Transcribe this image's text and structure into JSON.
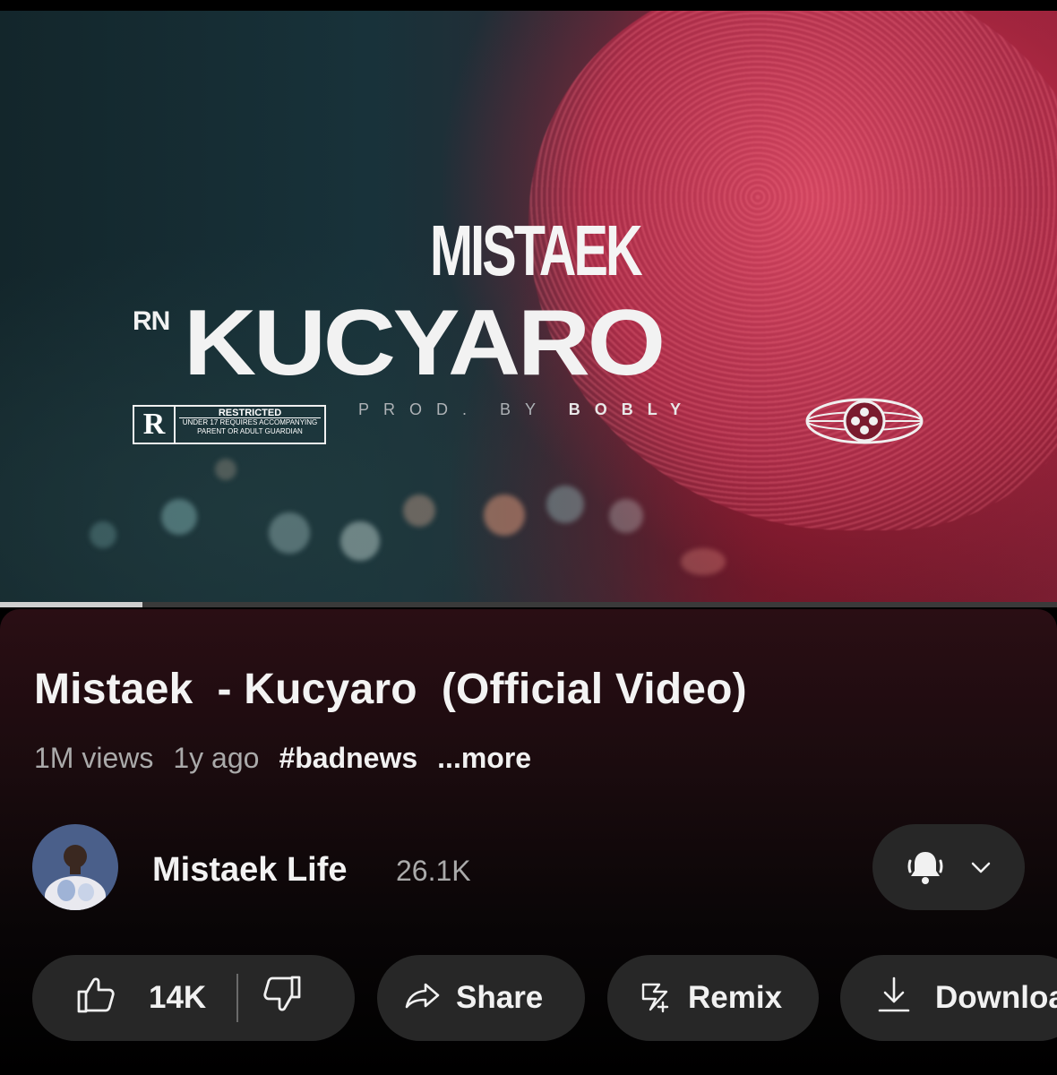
{
  "video": {
    "artist_logo": "MISTAEK",
    "feature_logo": "RN",
    "song_logo": "KUCYARO",
    "prod_label": "PROD. BY",
    "producer": "BOBLY",
    "rating": {
      "letter": "R",
      "heading": "RESTRICTED",
      "line1": "UNDER 17 REQUIRES ACCOMPANYING",
      "line2": "PARENT OR ADULT GUARDIAN"
    },
    "progress": 0.135
  },
  "title": "Mistaek  - Kucyaro  (Official Video)",
  "meta": {
    "views": "1M views",
    "age": "1y ago",
    "hashtag": "#badnews",
    "more": "...more"
  },
  "channel": {
    "name": "Mistaek Life",
    "subscribers": "26.1K",
    "bell_icon": "bell-ringing-icon",
    "dropdown_icon": "chevron-down-icon"
  },
  "actions": {
    "likes": "14K",
    "share": "Share",
    "remix": "Remix",
    "download": "Download"
  },
  "colors": {
    "background": "#000000",
    "pill": "#272727",
    "secondary_text": "#aaaaaa",
    "accent_red": "#c8385a"
  }
}
